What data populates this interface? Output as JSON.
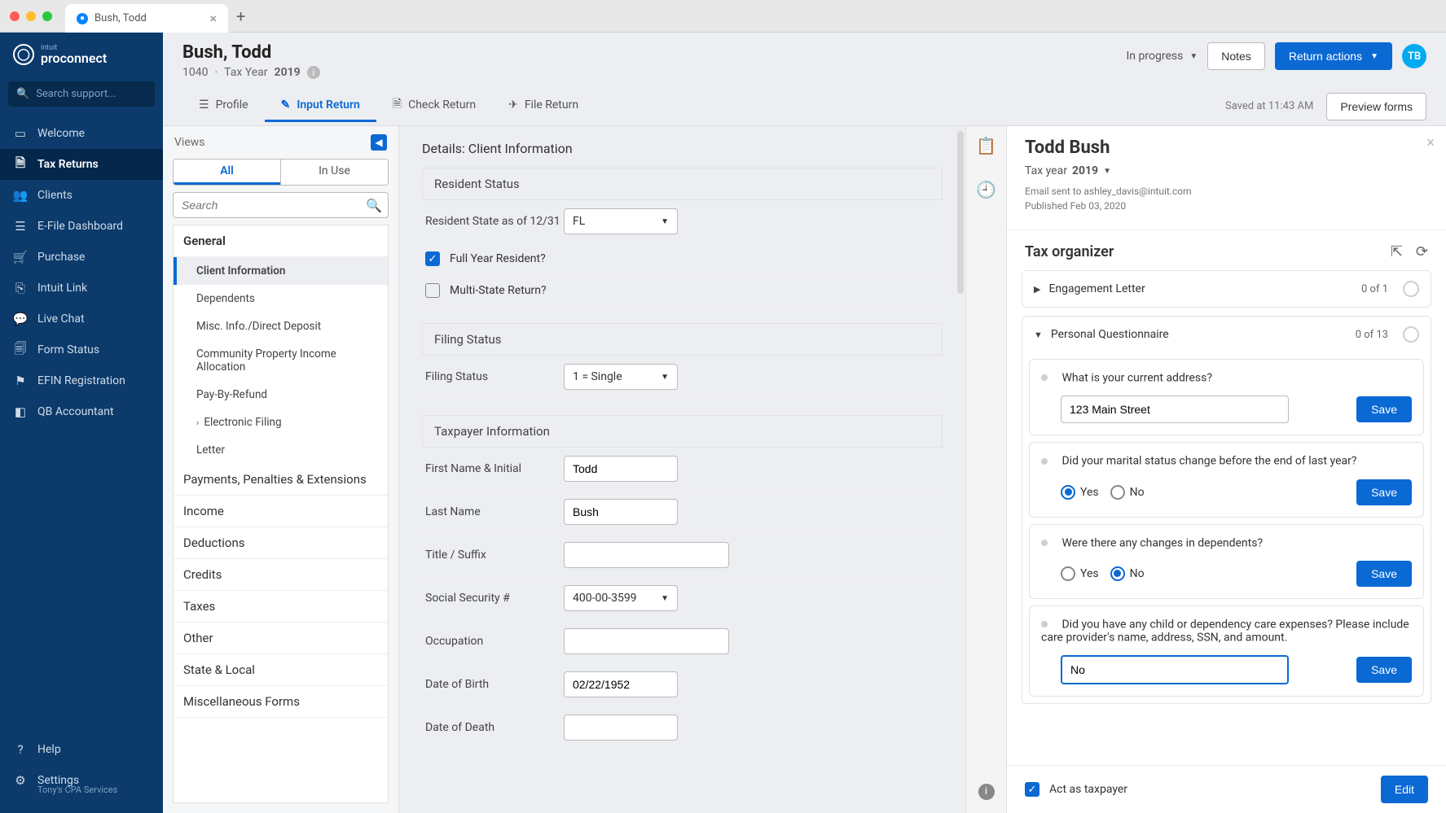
{
  "titlebar": {
    "tab_title": "Bush, Todd"
  },
  "brand": {
    "small": "intuit",
    "big": "proconnect"
  },
  "search_placeholder": "Search support...",
  "nav": {
    "welcome": "Welcome",
    "tax_returns": "Tax Returns",
    "clients": "Clients",
    "efile": "E-File Dashboard",
    "purchase": "Purchase",
    "intuit_link": "Intuit Link",
    "live_chat": "Live Chat",
    "form_status": "Form Status",
    "efin": "EFIN Registration",
    "qb": "QB Accountant",
    "help": "Help",
    "settings": "Settings",
    "settings_sub": "Tony's CPA Services"
  },
  "header": {
    "name": "Bush, Todd",
    "form": "1040",
    "tax_year_label": "Tax Year",
    "tax_year": "2019",
    "status": "In progress",
    "notes_btn": "Notes",
    "actions_btn": "Return actions",
    "avatar": "TB",
    "saved": "Saved at 11:43 AM",
    "preview_btn": "Preview forms"
  },
  "maintabs": {
    "profile": "Profile",
    "input": "Input Return",
    "check": "Check Return",
    "file": "File Return"
  },
  "views": {
    "title": "Views",
    "seg_all": "All",
    "seg_inuse": "In Use",
    "search_placeholder": "Search",
    "sections": {
      "general": "General",
      "general_items": {
        "client_info": "Client Information",
        "dependents": "Dependents",
        "misc": "Misc. Info./Direct Deposit",
        "cpi": "Community Property Income Allocation",
        "pbr": "Pay-By-Refund",
        "efile": "Electronic Filing",
        "letter": "Letter"
      },
      "payments": "Payments, Penalties & Extensions",
      "income": "Income",
      "deductions": "Deductions",
      "credits": "Credits",
      "taxes": "Taxes",
      "other": "Other",
      "state": "State & Local",
      "misc_forms": "Miscellaneous Forms"
    }
  },
  "form": {
    "details_title": "Details: Client Information",
    "resident_status": "Resident Status",
    "resident_state_label": "Resident State as of 12/31",
    "resident_state_val": "FL",
    "full_year": "Full Year Resident?",
    "multi_state": "Multi-State Return?",
    "filing_status": "Filing Status",
    "filing_status_val": "1 = Single",
    "taxpayer_info": "Taxpayer Information",
    "first_name_label": "First Name & Initial",
    "first_name_val": "Todd",
    "last_name_label": "Last Name",
    "last_name_val": "Bush",
    "title_suffix_label": "Title / Suffix",
    "ssn_label": "Social Security #",
    "ssn_val": "400-00-3599",
    "occupation_label": "Occupation",
    "dob_label": "Date of Birth",
    "dob_val": "02/22/1952",
    "dod_label": "Date of Death"
  },
  "panel": {
    "name": "Todd Bush",
    "tax_year_label": "Tax year",
    "tax_year": "2019",
    "email_sent": "Email sent to ashley_davis@intuit.com",
    "published": "Published Feb 03, 2020",
    "section_title": "Tax organizer",
    "engagement": "Engagement Letter",
    "eng_count": "0 of 1",
    "pq": "Personal Questionnaire",
    "pq_count": "0 of 13",
    "q1": "What is your current address?",
    "q1_val": "123 Main Street",
    "q2": "Did your marital status change before the end of last year?",
    "q3": "Were there any changes in dependents?",
    "q4": "Did you have any child or dependency care expenses? Please include care provider's name, address, SSN, and amount.",
    "q4_val": "No",
    "yes": "Yes",
    "no": "No",
    "save": "Save",
    "act_as": "Act as taxpayer",
    "edit": "Edit"
  }
}
